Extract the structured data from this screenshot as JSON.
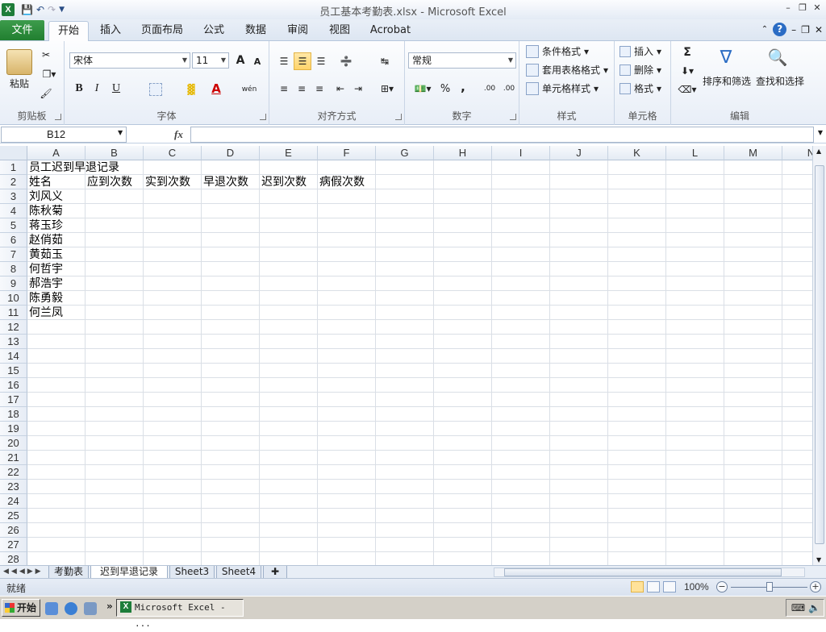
{
  "window": {
    "title": "员工基本考勤表.xlsx - Microsoft Excel",
    "app_icon": "X"
  },
  "tabs": [
    {
      "label": "文件"
    },
    {
      "label": "开始"
    },
    {
      "label": "插入"
    },
    {
      "label": "页面布局"
    },
    {
      "label": "公式"
    },
    {
      "label": "数据"
    },
    {
      "label": "审阅"
    },
    {
      "label": "视图"
    },
    {
      "label": "Acrobat"
    }
  ],
  "ribbon": {
    "clipboard": {
      "paste": "粘贴",
      "label": "剪贴板"
    },
    "font": {
      "name": "宋体",
      "size": "11",
      "bold": "B",
      "italic": "I",
      "underline": "U",
      "label": "字体",
      "grow": "A",
      "shrink": "A",
      "font_color": "A",
      "phonetic": "wén"
    },
    "alignment": {
      "label": "对齐方式"
    },
    "number": {
      "format": "常规",
      "percent": "%",
      "comma": ",",
      "label": "数字",
      "inc_decimal": ".00",
      "dec_decimal": ".00"
    },
    "styles": {
      "conditional": "条件格式",
      "table": "套用表格格式",
      "cell": "单元格样式",
      "label": "样式"
    },
    "cells": {
      "insert": "插入",
      "delete": "删除",
      "format": "格式",
      "label": "单元格"
    },
    "editing": {
      "sort": "排序和筛选",
      "find": "查找和选择",
      "label": "编辑",
      "sigma": "Σ"
    }
  },
  "formula_bar": {
    "name_box": "B12",
    "fx": "fx",
    "value": ""
  },
  "columns": [
    "A",
    "B",
    "C",
    "D",
    "E",
    "F",
    "G",
    "H",
    "I",
    "J",
    "K",
    "L",
    "M",
    "N"
  ],
  "rows": [
    "1",
    "2",
    "3",
    "4",
    "5",
    "6",
    "7",
    "8",
    "9",
    "10",
    "11",
    "12",
    "13",
    "14",
    "15",
    "16",
    "17",
    "18",
    "19",
    "20",
    "21",
    "22",
    "23",
    "24",
    "25",
    "26",
    "27",
    "28"
  ],
  "cells": {
    "A1": "员工迟到早退记录",
    "A2": "姓名",
    "B2": "应到次数",
    "C2": "实到次数",
    "D2": "早退次数",
    "E2": "迟到次数",
    "F2": "病假次数",
    "A3": "刘风义",
    "A4": "陈秋菊",
    "A5": "蒋玉珍",
    "A6": "赵俏茹",
    "A7": "黄茹玉",
    "A8": "何哲宇",
    "A9": "郝浩宇",
    "A10": "陈勇毅",
    "A11": "何兰凤"
  },
  "sheets": [
    {
      "label": "考勤表",
      "active": false
    },
    {
      "label": "迟到早退记录",
      "active": true
    },
    {
      "label": "Sheet3",
      "active": false
    },
    {
      "label": "Sheet4",
      "active": false
    }
  ],
  "status": {
    "text": "就绪",
    "zoom": "100%",
    "zoom_level_percent": 100
  },
  "taskbar": {
    "start": "开始",
    "app": "Microsoft Excel - ...",
    "more": "»"
  },
  "colors": {
    "file_tab": "#217f30",
    "accent": "#2b6cc4",
    "selection": "#ffd46b"
  }
}
